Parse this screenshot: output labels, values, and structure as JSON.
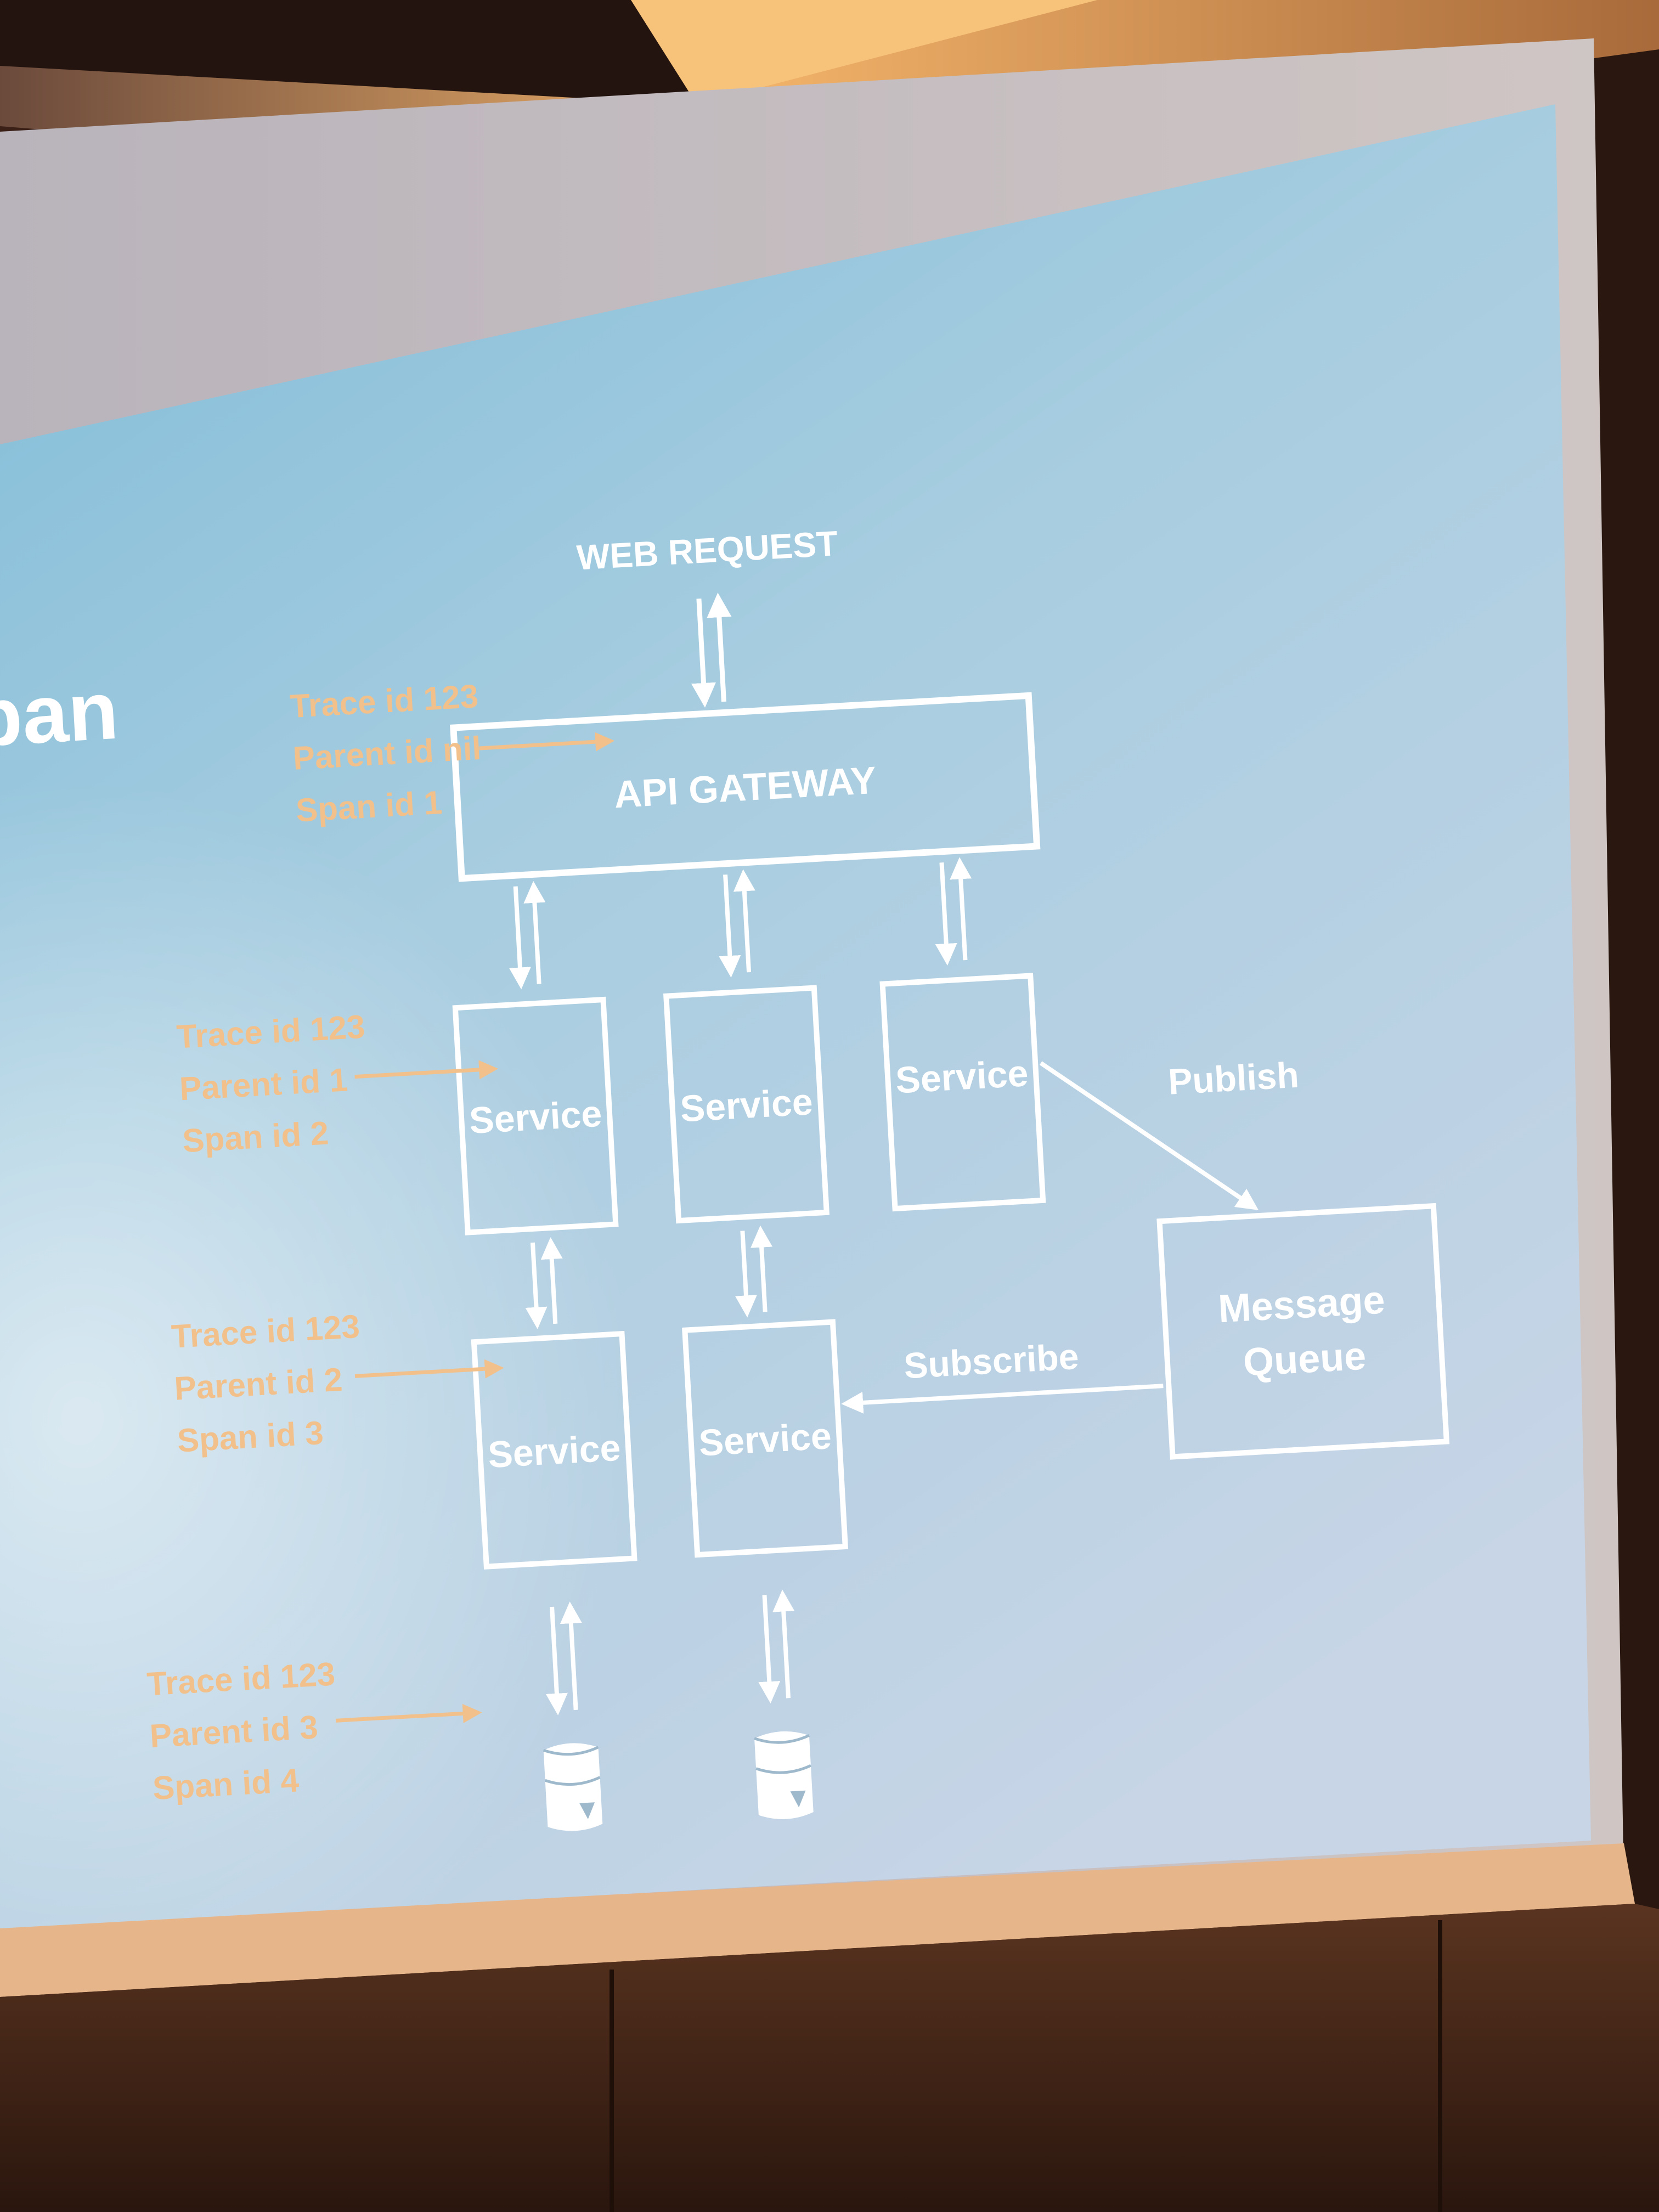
{
  "slide": {
    "partial_title": "pan",
    "web_request_label": "WEB REQUEST",
    "api_gateway_label": "API GATEWAY",
    "service_label": "Service",
    "message_queue_line1": "Message",
    "message_queue_line2": "Queue",
    "publish_label": "Publish",
    "subscribe_label": "Subscribe",
    "annotations": [
      {
        "trace": "Trace id 123",
        "parent": "Parent id nil",
        "span": "Span id 1"
      },
      {
        "trace": "Trace id 123",
        "parent": "Parent id 1",
        "span": "Span id 2"
      },
      {
        "trace": "Trace id 123",
        "parent": "Parent id 2",
        "span": "Span id 3"
      },
      {
        "trace": "Trace id 123",
        "parent": "Parent id 3",
        "span": "Span id 4"
      }
    ],
    "icons": [
      "database-icon",
      "database-icon"
    ]
  },
  "colors": {
    "annotation": "#f2c08a",
    "diagram_line": "#ffffff",
    "screen_top": "#8cc3dc",
    "screen_bottom": "#c4d6e6",
    "room_wall": "#3a2016",
    "ceiling_light": "#f6b86a"
  }
}
